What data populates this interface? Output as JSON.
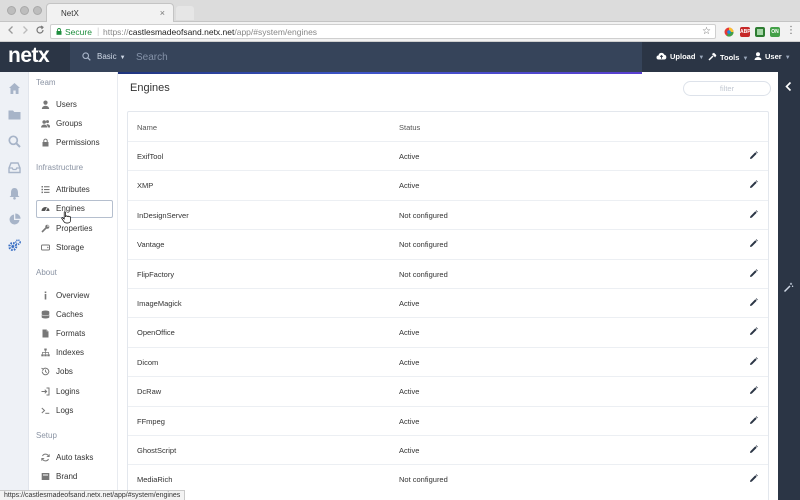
{
  "browser": {
    "tab_title": "NetX",
    "tab_close": "×",
    "secure_label": "Secure",
    "url_scheme": "https://",
    "url_host": "castlesmadeofsand.netx.net",
    "url_path": "/app/#system/engines",
    "status_url": "https://castlesmadeofsand.netx.net/app/#system/engines",
    "extensions": [
      {
        "label": "",
        "color": "#f0f0f0"
      },
      {
        "label": "ABP",
        "color": "#c62828"
      },
      {
        "label": "",
        "color": "#2e7d32"
      },
      {
        "label": "ON",
        "color": "#43a047"
      }
    ]
  },
  "header": {
    "logo": "netx",
    "search_mode": "Basic",
    "search_placeholder": "Search",
    "upload_label": "Upload",
    "tools_label": "Tools",
    "user_label": "User"
  },
  "sidebar": {
    "team_title": "Team",
    "team": [
      {
        "label": "Users",
        "icon": "user-icon"
      },
      {
        "label": "Groups",
        "icon": "groups-icon"
      },
      {
        "label": "Permissions",
        "icon": "lock-icon"
      }
    ],
    "infrastructure_title": "Infrastructure",
    "infrastructure": [
      {
        "label": "Attributes",
        "icon": "list-icon"
      },
      {
        "label": "Engines",
        "icon": "dashboard-icon"
      },
      {
        "label": "Properties",
        "icon": "wrench-icon"
      },
      {
        "label": "Storage",
        "icon": "hdd-icon"
      }
    ],
    "about_title": "About",
    "about": [
      {
        "label": "Overview",
        "icon": "info-icon"
      },
      {
        "label": "Caches",
        "icon": "database-icon"
      },
      {
        "label": "Formats",
        "icon": "file-icon"
      },
      {
        "label": "Indexes",
        "icon": "sitemap-icon"
      },
      {
        "label": "Jobs",
        "icon": "history-icon"
      },
      {
        "label": "Logins",
        "icon": "signin-icon"
      },
      {
        "label": "Logs",
        "icon": "terminal-icon"
      }
    ],
    "setup_title": "Setup",
    "setup": [
      {
        "label": "Auto tasks",
        "icon": "refresh-icon"
      },
      {
        "label": "Brand",
        "icon": "brand-icon"
      }
    ]
  },
  "main": {
    "title": "Engines",
    "filter_placeholder": "filter",
    "columns": {
      "name": "Name",
      "status": "Status"
    },
    "rows": [
      {
        "name": "ExifTool",
        "status": "Active"
      },
      {
        "name": "XMP",
        "status": "Active"
      },
      {
        "name": "InDesignServer",
        "status": "Not configured"
      },
      {
        "name": "Vantage",
        "status": "Not configured"
      },
      {
        "name": "FlipFactory",
        "status": "Not configured"
      },
      {
        "name": "ImageMagick",
        "status": "Active"
      },
      {
        "name": "OpenOffice",
        "status": "Active"
      },
      {
        "name": "Dicom",
        "status": "Active"
      },
      {
        "name": "DcRaw",
        "status": "Active"
      },
      {
        "name": "FFmpeg",
        "status": "Active"
      },
      {
        "name": "GhostScript",
        "status": "Active"
      },
      {
        "name": "MediaRich",
        "status": "Not configured"
      }
    ]
  },
  "colors": {
    "header_bg": "#2b3545",
    "search_bg": "#36445a",
    "rail_active": "#3a6fc4",
    "rail_icon": "#a7b4c8"
  }
}
